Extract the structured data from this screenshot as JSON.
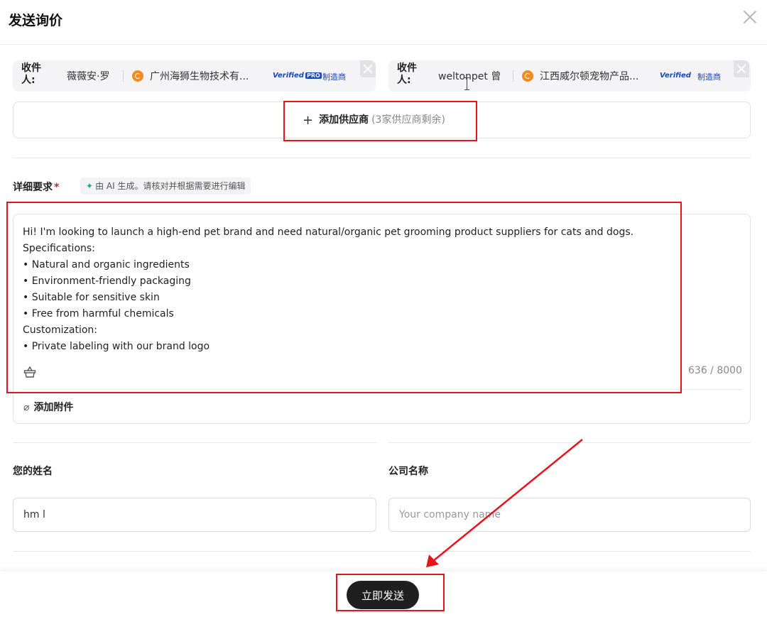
{
  "dialog": {
    "title": "发送询价",
    "close_icon": "close-icon"
  },
  "recipients": [
    {
      "label": "收件人:",
      "name": "薇薇安·罗",
      "company": "广州海狮生物技术有...",
      "verified": "Verified",
      "verified_badge": "PRO",
      "type": "制造商"
    },
    {
      "label": "收件人:",
      "name": "weltonpet 曾",
      "company": "江西威尔顿宠物产品...",
      "verified": "Verified",
      "type": "制造商"
    }
  ],
  "add_supplier": {
    "label": "添加供应商",
    "remaining": "(3家供应商剩余)"
  },
  "details": {
    "label": "详细要求",
    "required_mark": "*",
    "ai_tag": "由 AI 生成。请核对并根据需要进行编辑",
    "lines": [
      "Hi! I'm looking to launch a high-end pet brand and need natural/organic pet grooming product suppliers for cats and dogs.",
      "Specifications:",
      "• Natural and organic ingredients",
      "• Environment-friendly packaging",
      "• Suitable for sensitive skin",
      "• Free from harmful chemicals",
      "Customization:",
      "• Private labeling with our brand logo"
    ],
    "counter": "636 / 8000",
    "attachment": "添加附件"
  },
  "form": {
    "name_label": "您的姓名",
    "name_value": "hm l",
    "company_label": "公司名称",
    "company_placeholder": "Your company name"
  },
  "footer": {
    "send_label": "立即发送"
  },
  "colors": {
    "annotation_red": "#e8141b",
    "verified_blue": "#1a47b8",
    "ai_green": "#18b07a",
    "button_dark": "#1f1f1f"
  }
}
